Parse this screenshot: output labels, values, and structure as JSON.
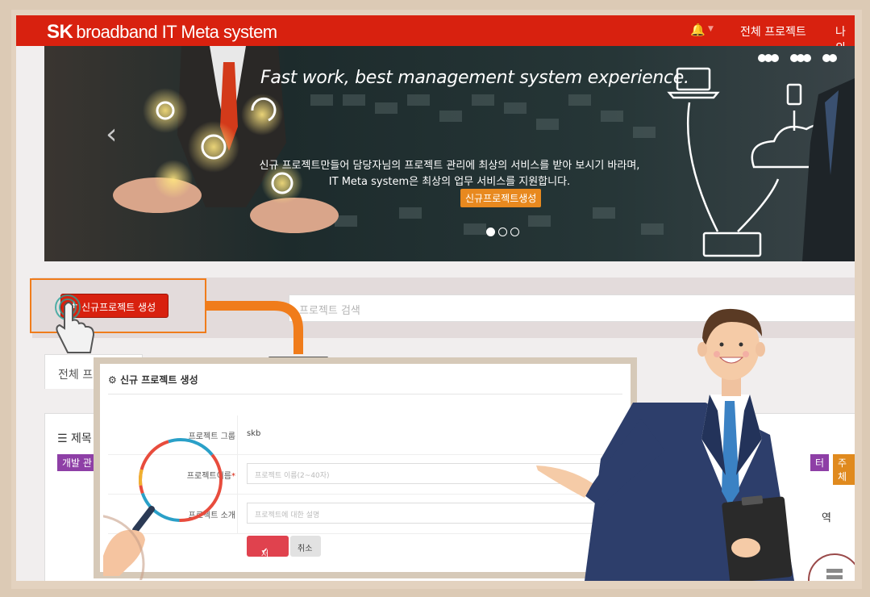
{
  "nav": {
    "logo_bold": "SK",
    "logo_text": "broadband IT Meta system",
    "bell_icon": "bell-icon",
    "items": [
      "전체 프로젝트",
      "나의"
    ]
  },
  "banner": {
    "headline": "Fast work, best management system experience.",
    "line1": "신규 프로젝트만들어 담당자님의 프로젝트 관리에 최상의 서비스를 받아 보시기 바라며,",
    "line2": "IT Meta system은 최상의 업무 서비스를 지원합니다.",
    "cta": "신규프로젝트생성",
    "slides": 3,
    "active_slide": 1
  },
  "toolbar": {
    "new_project_label": "신규프로젝트 생성",
    "search_placeholder": "프로젝트 검색"
  },
  "background": {
    "tab_label": "전체 프",
    "panel_title": "제목",
    "tags": [
      {
        "label": "개발 관",
        "color": "#8e3fa6"
      },
      {
        "label": "터",
        "color": "#8e3fa6"
      },
      {
        "label": "주체",
        "color": "#e08a1e"
      }
    ],
    "right_panel_text": "역"
  },
  "modal": {
    "title": "신규 프로젝트 생성",
    "group_label": "프로젝트 그룹",
    "group_value": "skb",
    "name_label": "프로젝트이름",
    "name_required": "*",
    "name_placeholder": "프로젝트 이름(2~40자)",
    "intro_label": "프로젝트 소개",
    "intro_placeholder": "프로젝트에 대한 설명",
    "save_label": "저장",
    "cancel_label": "취소"
  },
  "colors": {
    "brand_red": "#d8210f",
    "highlight_orange": "#f07c1b",
    "cta_orange": "#e8891f",
    "save_red": "#e0424e"
  }
}
